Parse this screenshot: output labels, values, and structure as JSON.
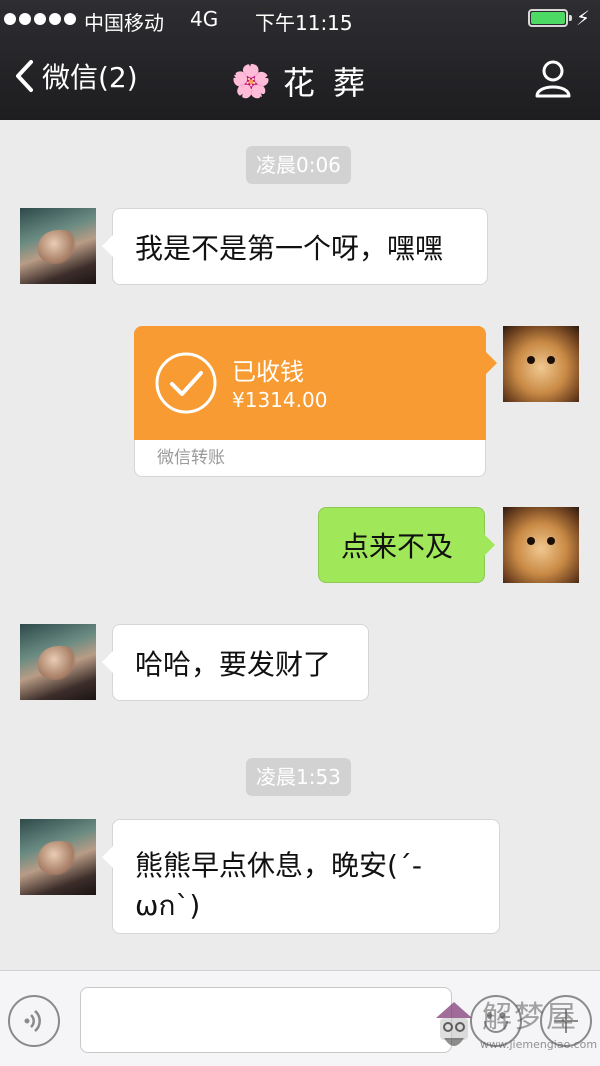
{
  "status_bar": {
    "carrier": "中国移动",
    "network": "4G",
    "time": "下午11:15",
    "battery_level": 1.0,
    "battery_color": "#4cd964"
  },
  "nav": {
    "back_label": "微信(2)",
    "title_emoji": "🌸",
    "title": "花 葬",
    "back_icon": "chevron-left-icon",
    "profile_icon": "person-icon"
  },
  "chat": {
    "time_1": "凌晨0:06",
    "msg_1": "我是不是第一个呀，嘿嘿",
    "transfer": {
      "status": "已收钱",
      "amount": "¥1314.00",
      "footer": "微信转账",
      "color": "#f79b32"
    },
    "msg_2": "点来不及",
    "msg_3": "哈哈，要发财了",
    "time_2": "凌晨1:53",
    "msg_4": "熊熊早点休息，晚安(´-ωก`)"
  },
  "input_bar": {
    "voice_icon": "voice-icon",
    "emoji_icon": "emoji-icon",
    "plus_icon": "plus-icon"
  },
  "watermark": {
    "text": "解梦屋",
    "url": "www.jiemengiao.com"
  },
  "colors": {
    "my_bubble": "#a0e75a",
    "background": "#ebebeb",
    "header": "#252528"
  }
}
